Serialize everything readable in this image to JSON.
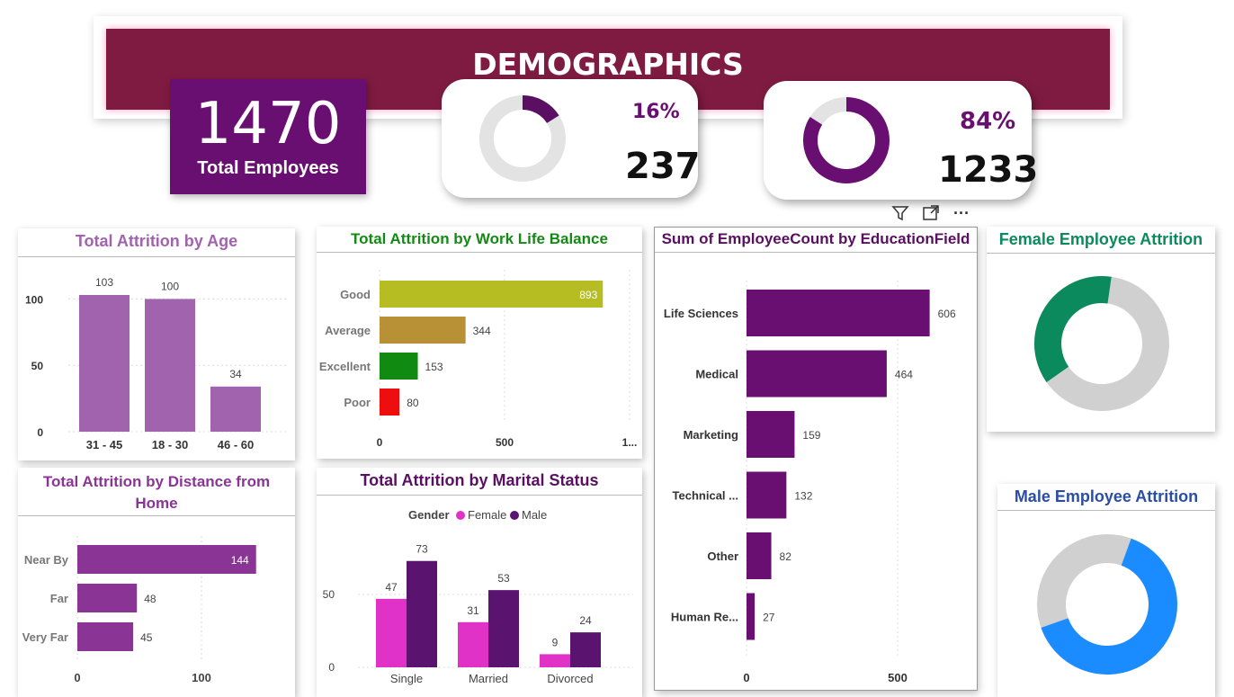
{
  "header": {
    "title": "DEMOGRAPHICS"
  },
  "kpi": {
    "value": "1470",
    "label": "Total Employees"
  },
  "attrition_yes": {
    "percent": "16%",
    "count": "237",
    "fraction": 0.16
  },
  "attrition_no": {
    "percent": "84%",
    "count": "1233",
    "fraction": 0.84
  },
  "toolbar": {
    "filter_icon": "filter-icon",
    "focus_icon": "focus-mode-icon",
    "more_label": "···"
  },
  "colors": {
    "purple": "#6a0f72",
    "age_bar": "#a163ae",
    "distance_bar": "#8a3595",
    "female": "#e032c6",
    "male": "#5a1470",
    "female_attr": "#0b8a5d",
    "male_attr": "#1a8cff",
    "ring_bg": "#d0d0d0"
  },
  "chart_data": [
    {
      "id": "age",
      "type": "bar",
      "title": "Total Attrition by Age",
      "categories": [
        "31 - 45",
        "18 - 30",
        "46 - 60"
      ],
      "values": [
        103,
        100,
        34
      ],
      "ylim": [
        0,
        110
      ],
      "yticks": [
        "0",
        "50",
        "100"
      ],
      "grid": true
    },
    {
      "id": "wlb",
      "type": "bar",
      "orientation": "horizontal",
      "title": "Total Attrition by Work Life Balance",
      "categories": [
        "Good",
        "Average",
        "Excellent",
        "Poor"
      ],
      "values": [
        893,
        344,
        153,
        80
      ],
      "bar_colors": [
        "#b5bd22",
        "#b89035",
        "#118a12",
        "#ee0e0e"
      ],
      "xticks": [
        "0",
        "500",
        "1..."
      ],
      "xlim": [
        0,
        1000
      ]
    },
    {
      "id": "edu",
      "type": "bar",
      "orientation": "horizontal",
      "title": "Sum of EmployeeCount by EducationField",
      "categories": [
        "Life Sciences",
        "Medical",
        "Marketing",
        "Technical ...",
        "Other",
        "Human Re..."
      ],
      "values": [
        606,
        464,
        159,
        132,
        82,
        27
      ],
      "xticks": [
        "0",
        "500"
      ],
      "xlim": [
        0,
        650
      ]
    },
    {
      "id": "female_attr",
      "type": "pie",
      "title": "Female Employee Attrition",
      "values": [
        0.37,
        0.63
      ]
    },
    {
      "id": "distance",
      "type": "bar",
      "orientation": "horizontal",
      "title": "Total Attrition by Distance from Home",
      "categories": [
        "Near By",
        "Far",
        "Very Far"
      ],
      "values": [
        144,
        48,
        45
      ],
      "xticks": [
        "0",
        "100"
      ],
      "xlim": [
        0,
        150
      ]
    },
    {
      "id": "marital",
      "type": "bar",
      "title": "Total Attrition by Marital Status",
      "legend_title": "Gender",
      "categories": [
        "Single",
        "Married",
        "Divorced"
      ],
      "series": [
        {
          "name": "Female",
          "values": [
            47,
            31,
            9
          ]
        },
        {
          "name": "Male",
          "values": [
            73,
            53,
            24
          ]
        }
      ],
      "yticks": [
        "0",
        "50"
      ],
      "ylim": [
        0,
        80
      ]
    },
    {
      "id": "male_attr",
      "type": "pie",
      "title": "Male Employee Attrition",
      "values": [
        0.64,
        0.36
      ]
    }
  ]
}
